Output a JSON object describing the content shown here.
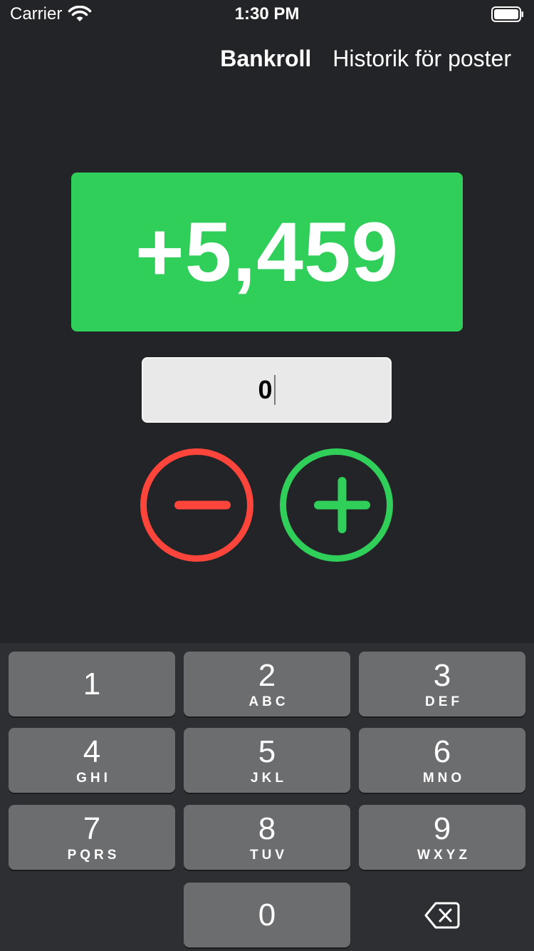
{
  "status_bar": {
    "carrier": "Carrier",
    "time": "1:30 PM"
  },
  "nav": {
    "tabs": [
      {
        "label": "Bankroll",
        "active": true
      },
      {
        "label": "Historik för poster",
        "active": false
      }
    ]
  },
  "balance": {
    "value": "+5,459",
    "color": "#30cf5a"
  },
  "amount_input": {
    "value": "0"
  },
  "actions": {
    "minus_color": "#fe453b",
    "plus_color": "#30cf5a"
  },
  "keypad": {
    "keys": [
      {
        "digit": "1",
        "letters": ""
      },
      {
        "digit": "2",
        "letters": "ABC"
      },
      {
        "digit": "3",
        "letters": "DEF"
      },
      {
        "digit": "4",
        "letters": "GHI"
      },
      {
        "digit": "5",
        "letters": "JKL"
      },
      {
        "digit": "6",
        "letters": "MNO"
      },
      {
        "digit": "7",
        "letters": "PQRS"
      },
      {
        "digit": "8",
        "letters": "TUV"
      },
      {
        "digit": "9",
        "letters": "WXYZ"
      },
      {
        "digit": "0",
        "letters": ""
      }
    ],
    "backspace_icon": "backspace-icon"
  }
}
